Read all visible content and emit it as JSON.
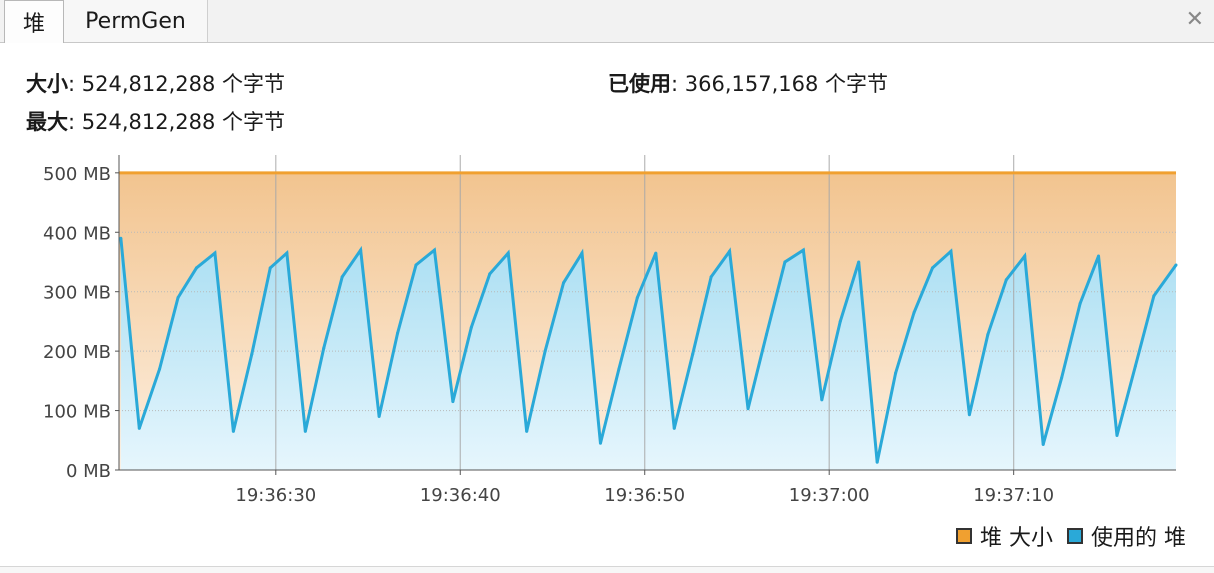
{
  "tabs": [
    {
      "label": "堆"
    },
    {
      "label": "PermGen"
    }
  ],
  "close_glyph": "✕",
  "info": {
    "size_label": "大小",
    "size_value": "524,812,288 个字节",
    "max_label": "最大",
    "max_value": "524,812,288 个字节",
    "used_label": "已使用",
    "used_value": "366,157,168 个字节",
    "colon": ":"
  },
  "colors": {
    "heap_size": "#f0a030",
    "used_heap": "#2aa9d8"
  },
  "chart_data": {
    "type": "area",
    "ylabels": [
      "500 MB",
      "400 MB",
      "300 MB",
      "200 MB",
      "100 MB",
      "0 MB"
    ],
    "yticks": [
      500,
      400,
      300,
      200,
      100,
      0
    ],
    "ylim": [
      0,
      530
    ],
    "xlim": [
      "19:36:21.5",
      "19:37:18.8"
    ],
    "xticks": [
      "19:36:30",
      "19:36:40",
      "19:36:50",
      "19:37:00",
      "19:37:10"
    ],
    "grid": true,
    "legend_position": "bottom-right",
    "series": [
      {
        "name": "堆 大小",
        "color": "#f0a030",
        "x": [
          "19:36:21.5",
          "19:37:18.8"
        ],
        "values": [
          500,
          500
        ]
      },
      {
        "name": "使用的 堆",
        "color": "#2aa9d8",
        "x": [
          "19:36:21.6",
          "19:36:22.6",
          "19:36:23.7",
          "19:36:24.7",
          "19:36:25.7",
          "19:36:26.7",
          "19:36:27.7",
          "19:36:28.7",
          "19:36:29.7",
          "19:36:30.6",
          "19:36:31.6",
          "19:36:32.6",
          "19:36:33.6",
          "19:36:34.6",
          "19:36:35.6",
          "19:36:36.6",
          "19:36:37.6",
          "19:36:38.6",
          "19:36:39.6",
          "19:36:40.6",
          "19:36:41.6",
          "19:36:42.6",
          "19:36:43.6",
          "19:36:44.6",
          "19:36:45.6",
          "19:36:46.6",
          "19:36:47.6",
          "19:36:48.6",
          "19:36:49.6",
          "19:36:50.6",
          "19:36:51.6",
          "19:36:52.6",
          "19:36:53.6",
          "19:36:54.6",
          "19:36:55.6",
          "19:36:56.6",
          "19:36:57.6",
          "19:36:58.6",
          "19:36:59.6",
          "19:37:00.6",
          "19:37:01.6",
          "19:37:02.6",
          "19:37:03.6",
          "19:37:04.6",
          "19:37:05.6",
          "19:37:06.6",
          "19:37:07.6",
          "19:37:08.6",
          "19:37:09.6",
          "19:37:10.6",
          "19:37:11.6",
          "19:37:12.6",
          "19:37:13.6",
          "19:37:14.6",
          "19:37:15.6",
          "19:37:16.6",
          "19:37:17.6",
          "19:37:18.8"
        ],
        "values": [
          390,
          70,
          170,
          290,
          340,
          365,
          65,
          195,
          340,
          365,
          65,
          205,
          325,
          370,
          90,
          230,
          345,
          370,
          115,
          240,
          330,
          365,
          65,
          200,
          315,
          365,
          45,
          170,
          290,
          365,
          70,
          195,
          325,
          368,
          103,
          228,
          350,
          370,
          118,
          250,
          350,
          13,
          163,
          265,
          340,
          368,
          93,
          228,
          320,
          360,
          43,
          155,
          280,
          360,
          58,
          175,
          293,
          345
        ]
      }
    ]
  }
}
